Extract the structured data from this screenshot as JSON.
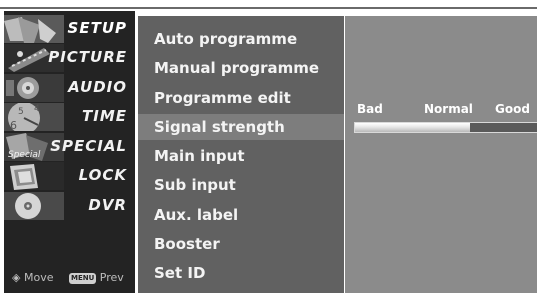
{
  "categories": [
    {
      "label": "SETUP",
      "icon": "setup-thumbnail",
      "active": true
    },
    {
      "label": "PICTURE",
      "icon": "picture-thumbnail"
    },
    {
      "label": "AUDIO",
      "icon": "audio-thumbnail"
    },
    {
      "label": "TIME",
      "icon": "time-thumbnail"
    },
    {
      "label": "SPECIAL",
      "icon": "special-thumbnail"
    },
    {
      "label": "LOCK",
      "icon": "lock-thumbnail"
    },
    {
      "label": "DVR",
      "icon": "dvr-thumbnail"
    }
  ],
  "legend": {
    "move_label": "Move",
    "menu_key": "MENU",
    "prev_label": "Prev"
  },
  "submenu": {
    "items": [
      "Auto programme",
      "Manual programme",
      "Programme edit",
      "Signal strength",
      "Main input",
      "Sub input",
      "Aux. label",
      "Booster",
      "Set ID"
    ],
    "selected": "Signal strength"
  },
  "signal": {
    "scale_bad": "Bad",
    "scale_normal": "Normal",
    "scale_good": "Good",
    "level_fraction": 0.63
  },
  "colors": {
    "left_column": "#232323",
    "submenu_bg": "#616161",
    "selected_row": "#7d7d7d",
    "right_panel": "#8b8b8b"
  }
}
